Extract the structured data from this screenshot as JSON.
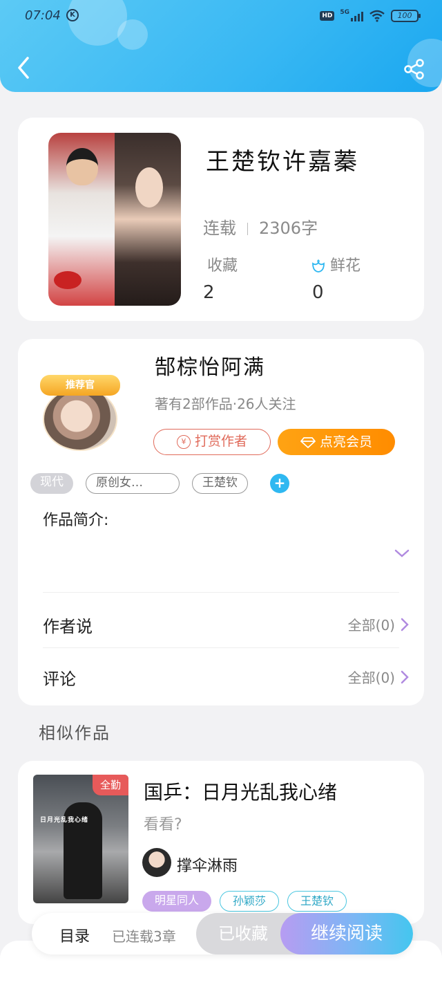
{
  "status_bar": {
    "time": "07:04",
    "k_badge": "K",
    "hd": "HD",
    "network": "5G",
    "battery": "100"
  },
  "book": {
    "title": "王楚钦许嘉蓁",
    "status": "连载",
    "word_count": "2306字",
    "favorites_label": "收藏",
    "favorites_value": "2",
    "flowers_label": "鲜花",
    "flowers_value": "0"
  },
  "author": {
    "badge": "推荐官",
    "name": "郜棕怡阿满",
    "meta": "著有2部作品·26人关注",
    "tip_label": "打赏作者",
    "tip_icon": "¥",
    "vip_label": "点亮会员",
    "tags": [
      "现代",
      "原创女…",
      "王楚钦"
    ],
    "add_tag": "+"
  },
  "intro": {
    "label": "作品简介:"
  },
  "rows": {
    "author_says_label": "作者说",
    "author_says_count": "全部(0)",
    "comments_label": "评论",
    "comments_count": "全部(0)"
  },
  "similar": {
    "section_title": "相似作品",
    "badge": "全勤",
    "cover_caption": "日月光乱我心绪",
    "title": "国乒：日月光乱我心绪",
    "desc": "看看?",
    "author": "撑伞淋雨",
    "tags": [
      "明星同人",
      "孙颖莎",
      "王楚钦"
    ]
  },
  "bottom": {
    "toc": "目录",
    "serial_info": "已连载3章",
    "fav_button": "已收藏",
    "read_button": "继续阅读"
  },
  "colors": {
    "header_blue": "#37b7f3",
    "vip_orange": "#ff9a0a",
    "tip_red": "#e06a5a",
    "accent_cyan": "#2fb8f1",
    "purple_tag": "#c9a8ec"
  },
  "icons": [
    "back-icon",
    "share-icon",
    "flower-icon",
    "yen-icon",
    "diamond-icon",
    "plus-icon",
    "chevron-down-icon",
    "chevron-right-icon"
  ]
}
